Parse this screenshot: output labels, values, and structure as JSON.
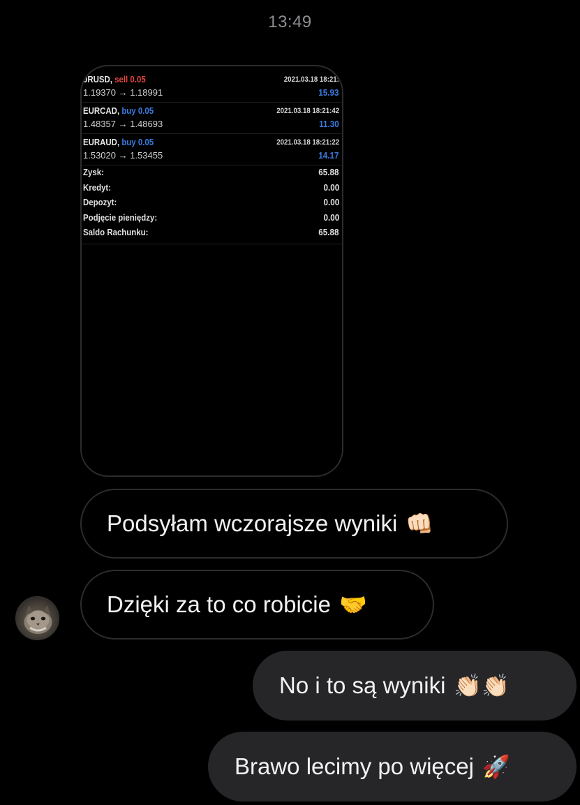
{
  "timestamp": "13:49",
  "shared_image": {
    "trades": [
      {
        "symbol": "JRUSD,",
        "side": "sell 0.05",
        "side_type": "sell",
        "date": "2021.03.18 18:21:",
        "prices": "1.19370 → 1.18991",
        "profit": "15.93"
      },
      {
        "symbol": "EURCAD,",
        "side": "buy 0.05",
        "side_type": "buy",
        "date": "2021.03.18 18:21:42",
        "prices": "1.48357 → 1.48693",
        "profit": "11.30"
      },
      {
        "symbol": "EURAUD,",
        "side": "buy 0.05",
        "side_type": "buy",
        "date": "2021.03.18 18:21:22",
        "prices": "1.53020 → 1.53455",
        "profit": "14.17"
      }
    ],
    "summary": [
      {
        "label": "Zysk:",
        "value": "65.88"
      },
      {
        "label": "Kredyt:",
        "value": "0.00"
      },
      {
        "label": "Depozyt:",
        "value": "0.00"
      },
      {
        "label": "Podjęcie pieniędzy:",
        "value": "0.00"
      },
      {
        "label": "Saldo Rachunku:",
        "value": "65.88"
      }
    ]
  },
  "messages": [
    {
      "text": "Podsyłam wczorajsze wyniki",
      "emoji": "👊🏻",
      "direction": "incoming"
    },
    {
      "text": "Dzięki za to co robicie",
      "emoji": "🤝",
      "direction": "incoming"
    },
    {
      "text": "No i to są wyniki",
      "emoji": "👏🏻👏🏻",
      "direction": "outgoing"
    },
    {
      "text": "Brawo lecimy po więcej",
      "emoji": "🚀",
      "direction": "outgoing"
    }
  ],
  "icons": {
    "avatar": "cat-avatar-icon"
  },
  "colors": {
    "background": "#000000",
    "incoming_border": "#2c2c2e",
    "outgoing_bubble": "#262628",
    "sell": "#e0463f",
    "buy": "#3b7be0",
    "timestamp": "#8e8e93"
  }
}
